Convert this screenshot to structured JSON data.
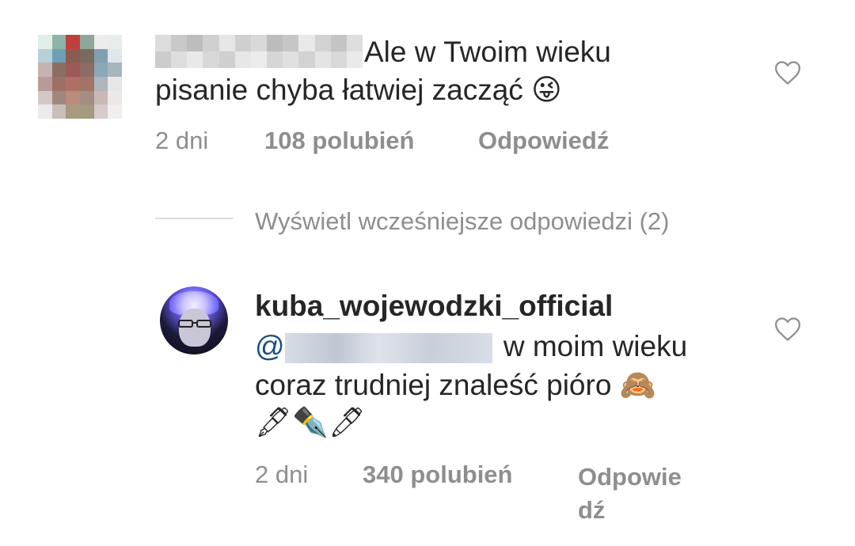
{
  "comment1": {
    "avatar_pixels": [
      "#e2efe9",
      "#8fb3a8",
      "#c0413c",
      "#8ea79a",
      "#ececec",
      "#e8ede9",
      "#b7d2d6",
      "#6f9fb4",
      "#8b5b4f",
      "#7b6a5f",
      "#7fa0b0",
      "#dfe7ea",
      "#c7b3ae",
      "#8a6d63",
      "#9b5a53",
      "#8d6c66",
      "#8ca7b6",
      "#a6b6bf",
      "#b89a97",
      "#9e6f65",
      "#b06f64",
      "#a27367",
      "#aeb5bf",
      "#e6e6e8",
      "#d3c8c3",
      "#a0877d",
      "#ba8c7d",
      "#a48d84",
      "#c9b8b6",
      "#ece8e8",
      "#eceaea",
      "#c7bfb8",
      "#a89a7e",
      "#a59980",
      "#d4cbca",
      "#f1eeee"
    ],
    "name_blur_pixels": [
      "#dcdcdc",
      "#c9c9c9",
      "#bdbdbd",
      "#d0d0d0",
      "#e6e6e6",
      "#cfcfcf",
      "#d9d9d9",
      "#bcbcbc",
      "#c6c6c6",
      "#e9e9e9",
      "#d2d2d2",
      "#c4c4c4",
      "#dedede",
      "#cccccc",
      "#dedede",
      "#e9e9e9",
      "#d8d8d8",
      "#cfcfcf",
      "#e7e7e7",
      "#ececec",
      "#d6d6d6",
      "#e0e0e0",
      "#d3d3d3",
      "#e4e4e4",
      "#d9d9d9",
      "#eaeaea"
    ],
    "text_line1_visible": "Ale w Twoim wieku",
    "text_line2": "pisanie chyba łatwiej zacząć 😜",
    "time": "2 dni",
    "likes": "108 polubień",
    "reply": "Odpowiedź"
  },
  "view_previous": "Wyświetl wcześniejsze odpowiedzi (2)",
  "comment2": {
    "username": "kuba_wojewodzki_official",
    "mention_prefix": "@",
    "text_line1": "w moim wieku",
    "text_line2": "coraz trudniej znaleść pióro 🙈",
    "text_line3": "🖋✒️🖊",
    "time": "2 dni",
    "likes": "340 polubień",
    "reply_line1": "Odpowie",
    "reply_line2": "dź"
  },
  "colors": {
    "text": "#262626",
    "meta": "#8e8e8e",
    "mention": "#1a4f86",
    "divider": "#dbdbdb"
  },
  "icons": {
    "like": "heart-outline-icon"
  }
}
